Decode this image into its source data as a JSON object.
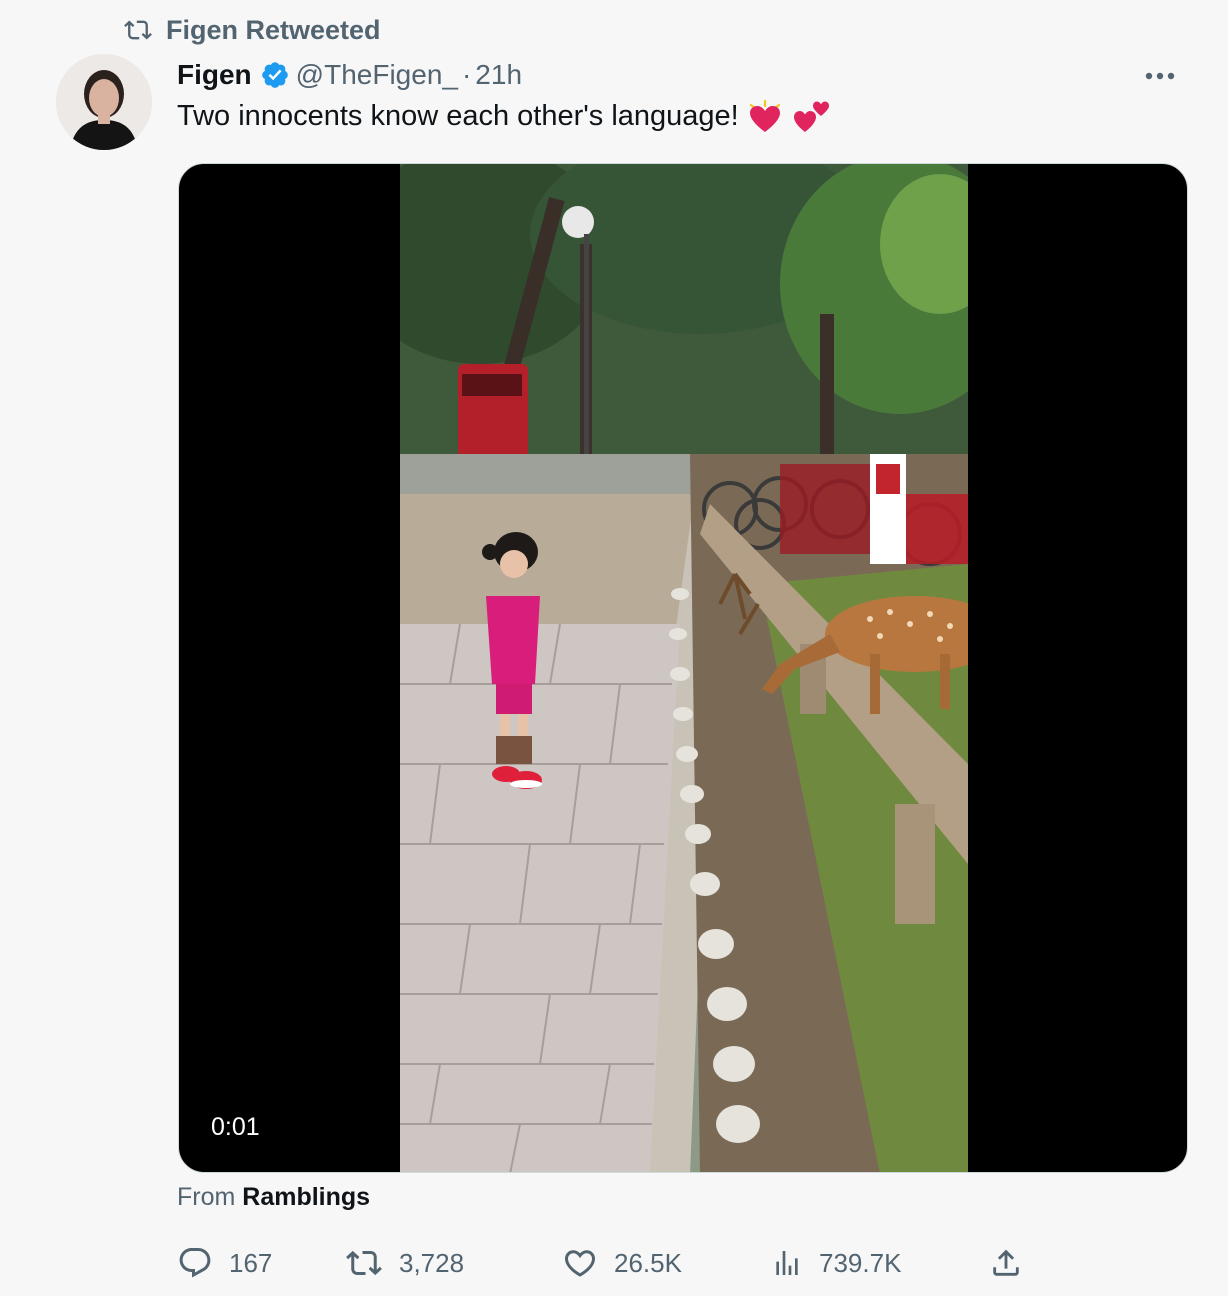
{
  "retweet_header": {
    "label": "Figen Retweeted"
  },
  "author": {
    "name": "Figen",
    "handle": "@TheFigen_",
    "separator": "·",
    "time": "21h"
  },
  "tweet": {
    "text": "Two innocents know each other's language!"
  },
  "media": {
    "timecode": "0:01"
  },
  "source": {
    "prefix": "From",
    "name": "Ramblings"
  },
  "actions": {
    "replies": "167",
    "retweets": "3,728",
    "likes": "26.5K",
    "views": "739.7K"
  },
  "colors": {
    "verified": "#1d9bf0",
    "secondary_text": "#536471",
    "heart": "#e0245e"
  },
  "icons": [
    "retweet-icon",
    "verified-badge-icon",
    "more-icon",
    "reply-icon",
    "like-icon",
    "views-icon",
    "share-icon"
  ]
}
